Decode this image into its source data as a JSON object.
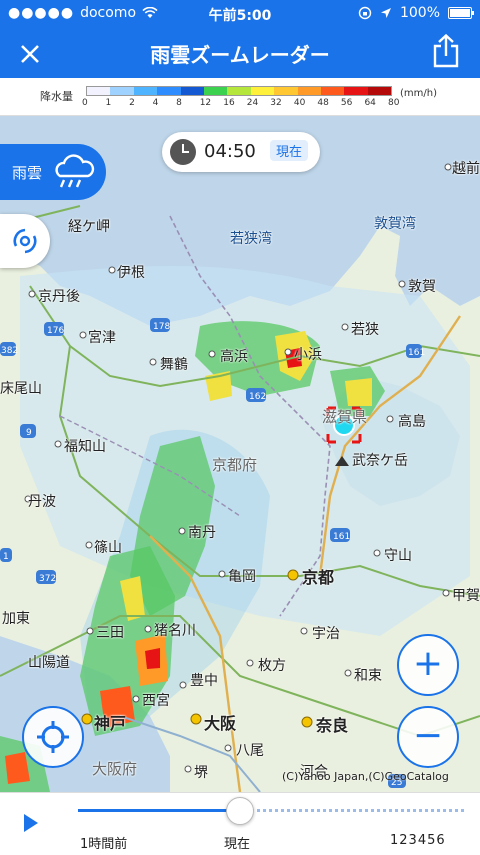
{
  "status_bar": {
    "carrier": "docomo",
    "time": "午前5:00",
    "battery": "100%"
  },
  "header": {
    "title": "雨雲ズームレーダー",
    "close_icon": "close-icon",
    "share_icon": "share-icon"
  },
  "legend": {
    "label": "降水量",
    "unit": "(mm/h)",
    "ticks": [
      "0",
      "1",
      "2",
      "4",
      "8",
      "12",
      "16",
      "24",
      "32",
      "40",
      "48",
      "56",
      "64",
      "80"
    ],
    "colors": [
      "#f2f2ff",
      "#a0d2ff",
      "#4fb4ff",
      "#2e8cff",
      "#1458d2",
      "#3cd250",
      "#b4e63c",
      "#fff03c",
      "#ffc832",
      "#ff9a28",
      "#ff5a1e",
      "#e61414",
      "#b40a0a"
    ]
  },
  "map": {
    "time_chip": {
      "time": "04:50",
      "now_label": "現在"
    },
    "layer_button": {
      "label": "雨雲",
      "icon": "rain-cloud-icon"
    },
    "typhoon_icon": "typhoon-icon",
    "places": {
      "echizen": "越前",
      "tsuruga_bay": "敦賀湾",
      "kyogamisaki": "経ケ岬",
      "wakasa_bay": "若狭湾",
      "ine": "伊根",
      "tsuruga": "敦賀",
      "kyotango": "京丹後",
      "miyazu": "宮津",
      "wakasa": "若狭",
      "maizuru": "舞鶴",
      "takahama": "高浜",
      "obama": "小浜",
      "tokoyama": "床尾山",
      "shiga": "滋賀県",
      "takashima": "高島",
      "fukuchiyama": "福知山",
      "kyoto_pref": "京都府",
      "bunagatake": "武奈ケ岳",
      "tamba": "丹波",
      "nantan": "南丹",
      "sasayama": "篠山",
      "moriyama": "守山",
      "kameoka": "亀岡",
      "kyoto": "京都",
      "koka": "甲賀",
      "kato": "加東",
      "sanda": "三田",
      "inagawa": "猪名川",
      "uji": "宇治",
      "sanyo_road": "山陽道",
      "hirakata": "枚方",
      "wazuka": "和束",
      "nishinomiya": "西宮",
      "toyonaka": "豊中",
      "kobe": "神戸",
      "osaka": "大阪",
      "nara": "奈良",
      "yao": "八尾",
      "osaka_pref": "大阪府",
      "sakai": "堺",
      "kawai": "河合"
    },
    "route_numbers": [
      "176",
      "178",
      "162",
      "161",
      "372",
      "382",
      "9",
      "1",
      "25"
    ],
    "copyright": "(C)Yahoo Japan,(C)GeoCatalog",
    "zoom_in_label": "+",
    "zoom_out_label": "−",
    "locate_icon": "crosshair-icon"
  },
  "timeline": {
    "play_icon": "play-icon",
    "past_label": "1時間前",
    "now_label": "現在",
    "future_label": "123456"
  }
}
